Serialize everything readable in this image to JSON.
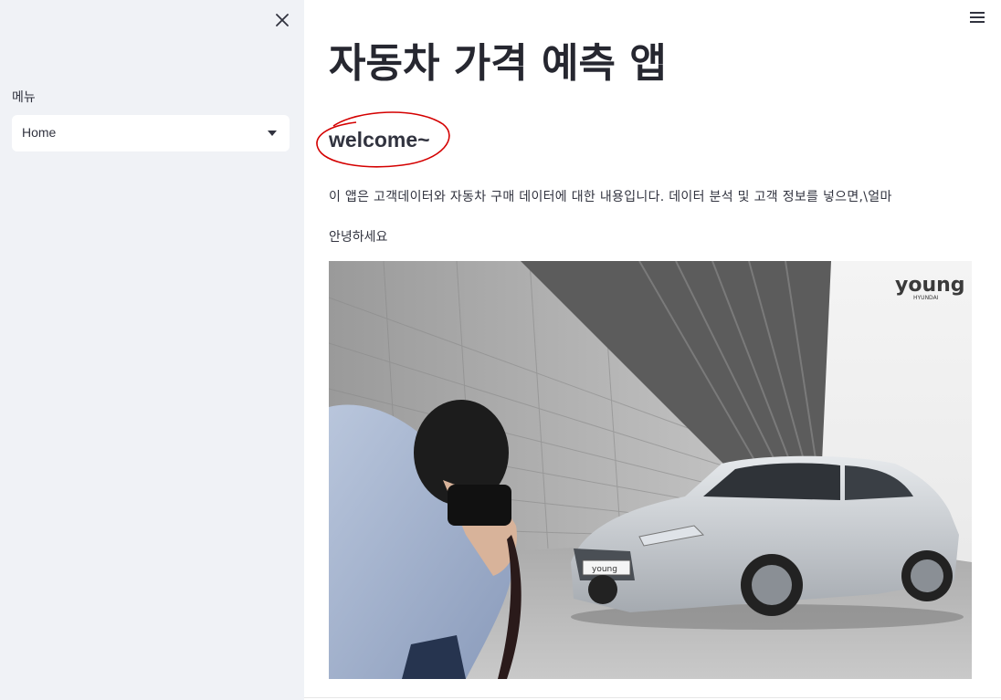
{
  "sidebar": {
    "select_label": "메뉴",
    "select_value": "Home"
  },
  "main": {
    "title": "자동차 가격 예측 앱",
    "welcome": "welcome~",
    "description": "이 앱은 고객데이터와 자동차 구매 데이터에 대한 내용입니다. 데이터 분석 및 고객 정보를 넣으면,\\얼마",
    "greeting": "안녕하세요",
    "image": {
      "watermark_brand": "young",
      "watermark_sub": "HYUNDAI",
      "plate_text": "young"
    }
  },
  "colors": {
    "sidebar_bg": "#f0f2f6",
    "text": "#31333f",
    "annotation_red": "#d40000"
  },
  "icons": [
    "close-icon",
    "hamburger-menu-icon",
    "chevron-down-icon"
  ]
}
